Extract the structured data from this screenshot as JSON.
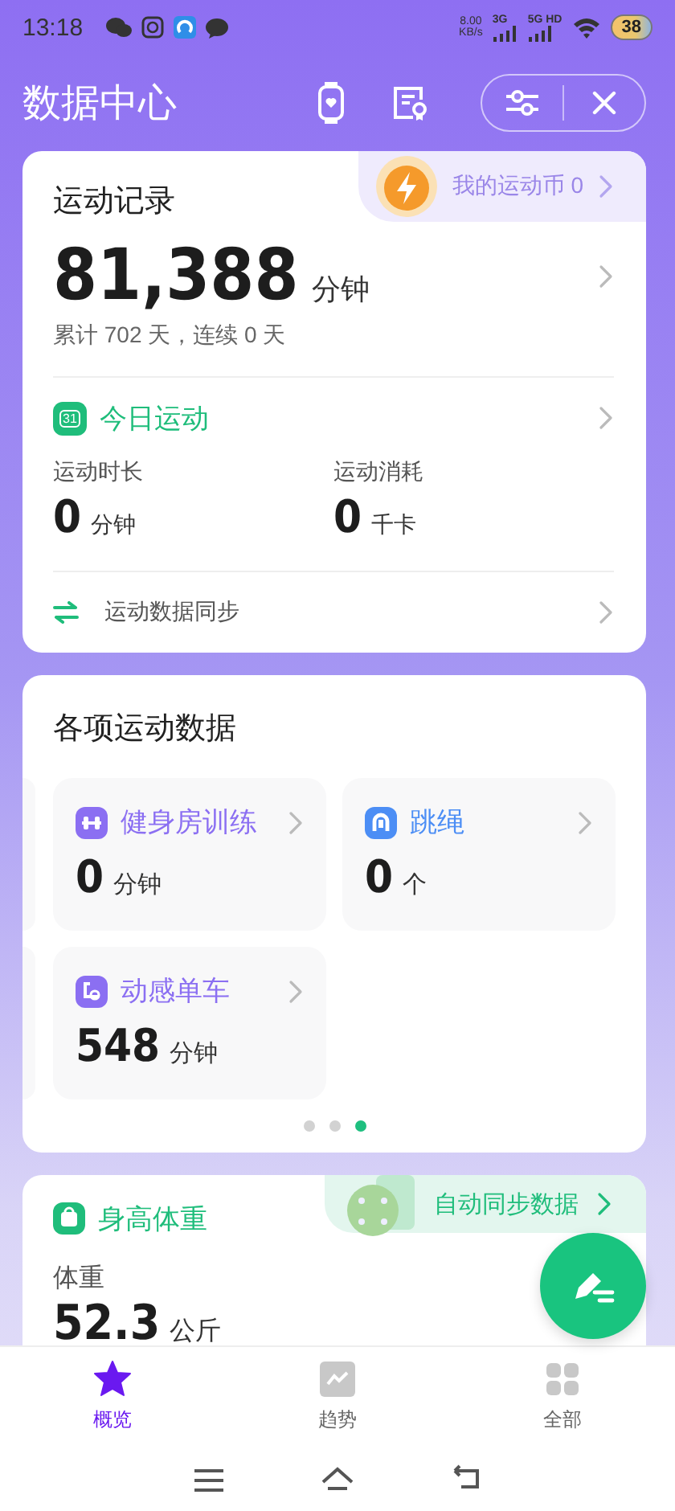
{
  "status_bar": {
    "time": "13:18",
    "net_speed": "8.00",
    "net_unit": "KB/s",
    "sim1": "3G",
    "sim2": "5G HD",
    "battery": "38"
  },
  "header": {
    "title": "数据中心"
  },
  "record": {
    "title": "运动记录",
    "coin_label": "我的运动币 0",
    "total": "81,388",
    "total_unit": "分钟",
    "summary": "累计 702 天，连续 0 天",
    "today_title": "今日运动",
    "today_badge": "31",
    "stats": [
      {
        "label": "运动时长",
        "value": "0",
        "unit": "分钟"
      },
      {
        "label": "运动消耗",
        "value": "0",
        "unit": "千卡"
      }
    ],
    "sync": "运动数据同步"
  },
  "sports": {
    "title": "各项运动数据",
    "items": [
      {
        "kind": "gym",
        "name": "健身房训练",
        "value": "0",
        "unit": "分钟",
        "color": "#8b6ff2"
      },
      {
        "kind": "rope",
        "name": "跳绳",
        "value": "0",
        "unit": "个",
        "color": "#4c8ef5"
      },
      {
        "kind": "bike",
        "name": "动感单车",
        "value": "548",
        "unit": "分钟",
        "color": "#8b6ff2"
      }
    ],
    "pages": [
      {
        "selected": false
      },
      {
        "selected": false
      },
      {
        "selected": true
      }
    ]
  },
  "body": {
    "title": "身高体重",
    "sync_label": "自动同步数据",
    "metric": "体重",
    "value": "52.3",
    "unit": "公斤"
  },
  "nav": [
    {
      "kind": "overview",
      "label": "概览",
      "selected": true
    },
    {
      "kind": "trend",
      "label": "趋势",
      "selected": false
    },
    {
      "kind": "all",
      "label": "全部",
      "selected": false
    }
  ]
}
